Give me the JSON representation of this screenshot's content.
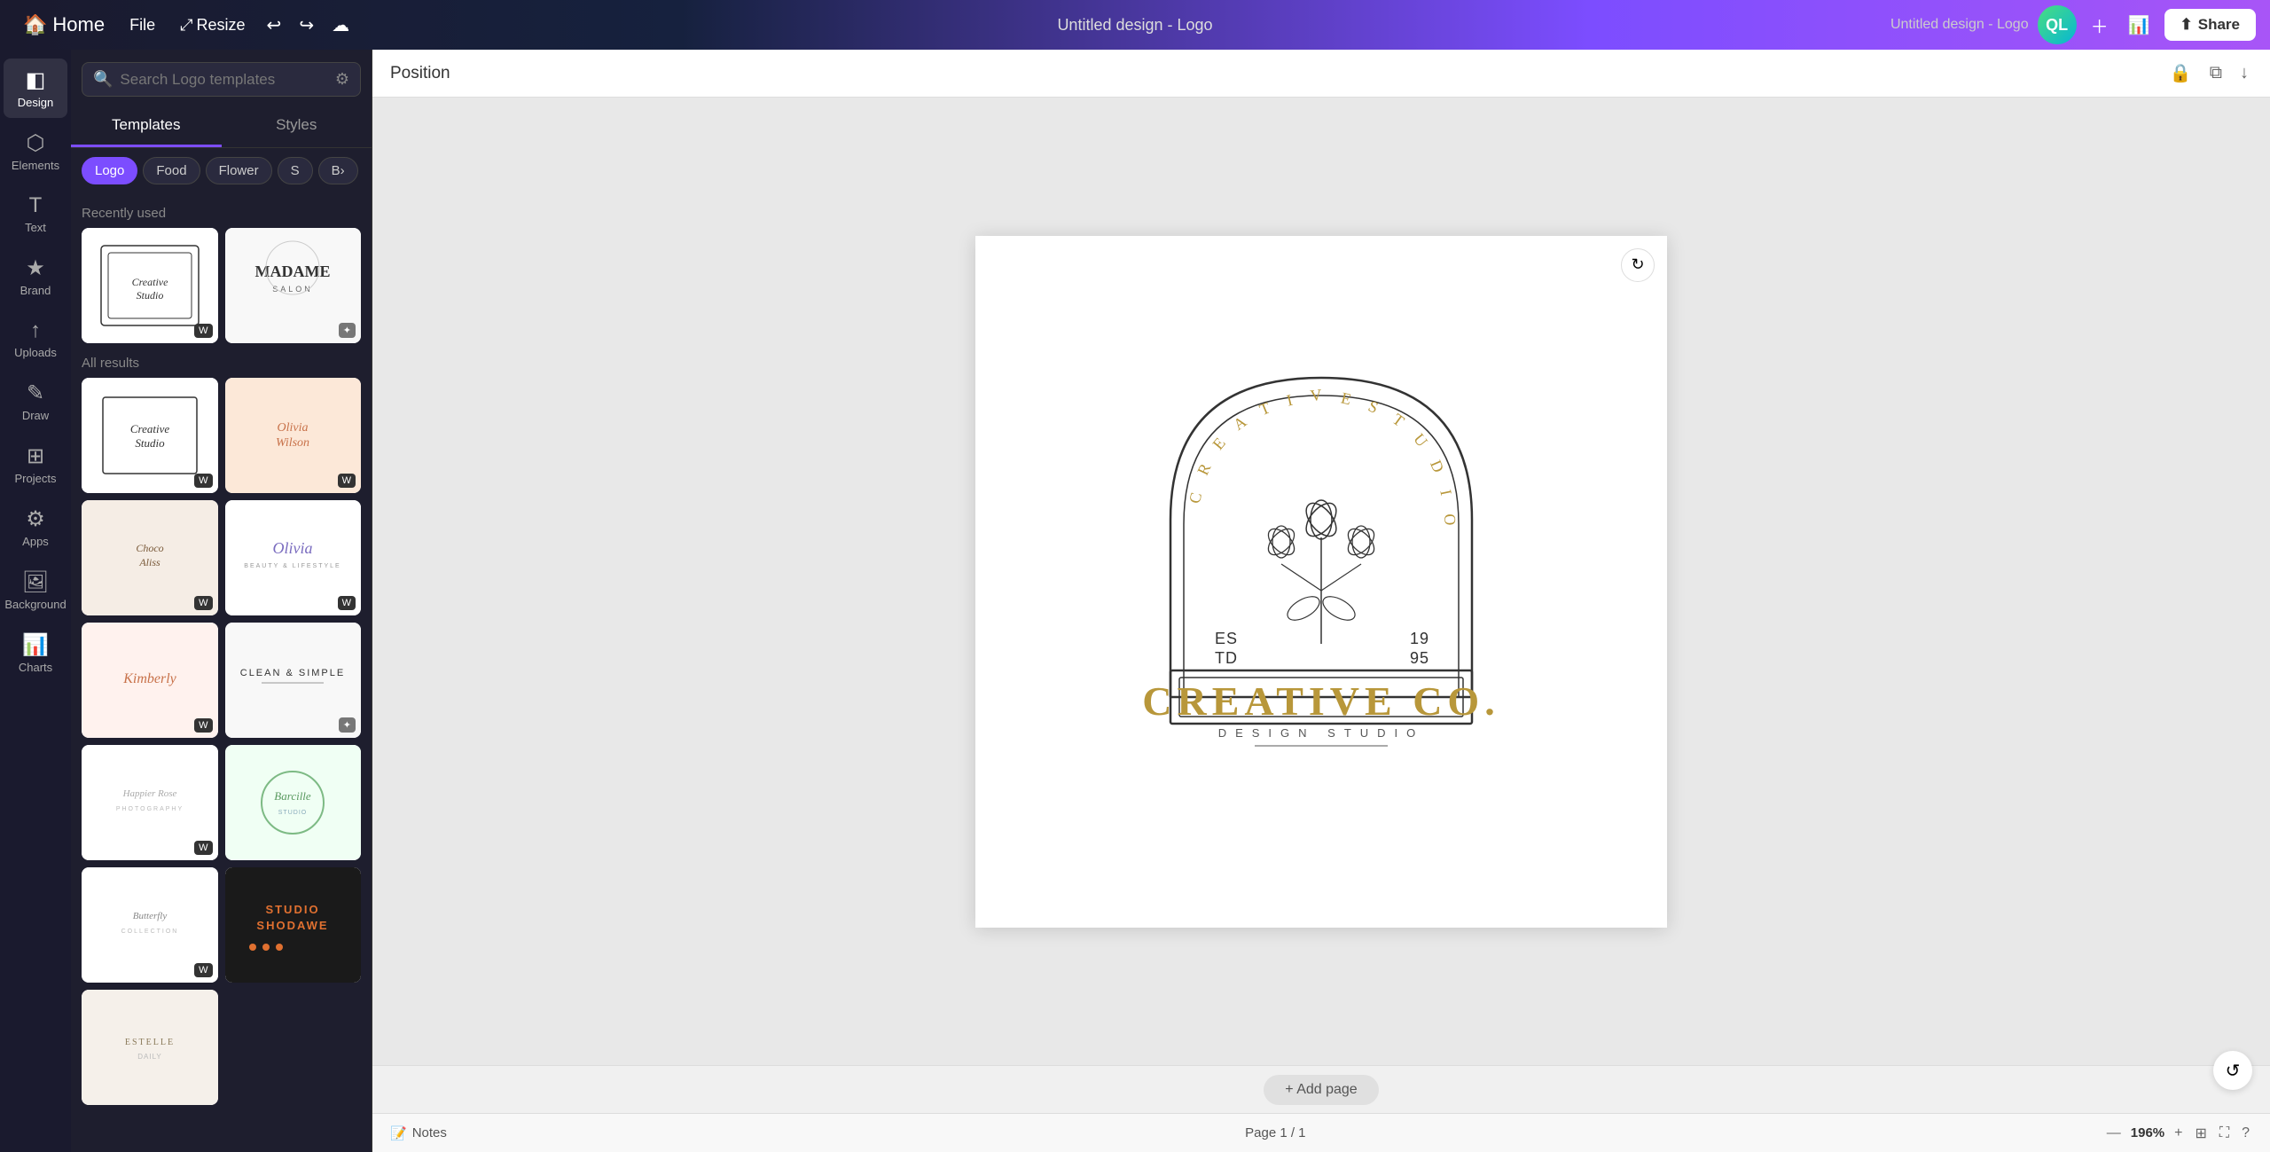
{
  "topbar": {
    "home_label": "Home",
    "file_label": "File",
    "resize_label": "Resize",
    "title": "Untitled design - Logo",
    "avatar_initials": "QL",
    "share_label": "Share"
  },
  "sidebar_icons": [
    {
      "id": "design",
      "label": "Design",
      "icon": "◧",
      "active": true
    },
    {
      "id": "elements",
      "label": "Elements",
      "icon": "⬡"
    },
    {
      "id": "text",
      "label": "Text",
      "icon": "T"
    },
    {
      "id": "brand",
      "label": "Brand",
      "icon": "★"
    },
    {
      "id": "uploads",
      "label": "Uploads",
      "icon": "↑"
    },
    {
      "id": "draw",
      "label": "Draw",
      "icon": "✎"
    },
    {
      "id": "projects",
      "label": "Projects",
      "icon": "⊞"
    },
    {
      "id": "apps",
      "label": "Apps",
      "icon": "⚙"
    },
    {
      "id": "background",
      "label": "Background",
      "icon": "🖼"
    },
    {
      "id": "charts",
      "label": "Charts",
      "icon": "📊"
    }
  ],
  "panel": {
    "search_placeholder": "Search Logo templates",
    "tabs": [
      "Templates",
      "Styles"
    ],
    "active_tab": "Templates",
    "chips": [
      "Logo",
      "Food",
      "Flower",
      "S",
      "B>"
    ],
    "active_chip": "Logo",
    "recently_used_label": "Recently used",
    "all_results_label": "All results"
  },
  "canvas": {
    "toolbar_label": "Position",
    "add_page_label": "+ Add page",
    "notes_label": "Notes",
    "page_info": "Page 1 / 1",
    "zoom_level": "196%"
  },
  "logo": {
    "arc_text": "CREATIVE STUDIO",
    "est": "ES",
    "td": "TD",
    "year1": "19",
    "year2": "95",
    "main_text": "CREATIVE CO.",
    "sub_text": "DESIGN STUDIO"
  },
  "templates": {
    "recently_used": [
      {
        "id": "creative-studio",
        "label": "Creative Studio"
      },
      {
        "id": "madame",
        "label": "Madame"
      }
    ],
    "all": [
      {
        "id": "creative-studio-2",
        "label": "Creative Studio"
      },
      {
        "id": "olivia-wilson",
        "label": "Olivia Wilson"
      },
      {
        "id": "choco",
        "label": "Choco"
      },
      {
        "id": "olivia-script",
        "label": "Olivia"
      },
      {
        "id": "kimberly",
        "label": "Kimberly"
      },
      {
        "id": "clean-simple",
        "label": "Clean & Simple"
      },
      {
        "id": "happier-rose",
        "label": "Happier Rose"
      },
      {
        "id": "barcille",
        "label": "Barcille"
      },
      {
        "id": "butterfly",
        "label": "Butterfly"
      },
      {
        "id": "studio-shodawe",
        "label": "Studio Shodawe"
      },
      {
        "id": "estelle",
        "label": "Estelle"
      }
    ]
  }
}
